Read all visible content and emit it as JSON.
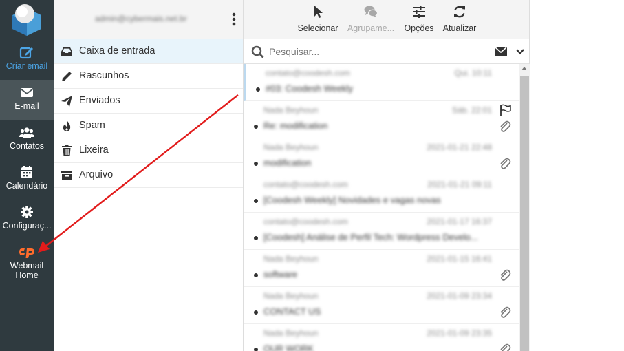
{
  "nav": {
    "items": [
      {
        "label": "Criar email",
        "icon": "compose-icon"
      },
      {
        "label": "E-mail",
        "icon": "envelope-icon"
      },
      {
        "label": "Contatos",
        "icon": "contacts-icon"
      },
      {
        "label": "Calendário",
        "icon": "calendar-icon"
      },
      {
        "label": "Configuraç...",
        "icon": "gear-icon"
      },
      {
        "label": "Webmail Home",
        "icon": "cpanel-icon"
      }
    ],
    "colors": {
      "bg": "#2f3a3f",
      "active": "#4a5559",
      "create": "#4ca5e6",
      "cpanel": "#ff6c2c"
    }
  },
  "account": {
    "email": "admin@cybermais.net.br"
  },
  "folders": [
    {
      "label": "Caixa de entrada",
      "icon": "inbox-icon"
    },
    {
      "label": "Rascunhos",
      "icon": "pencil-icon"
    },
    {
      "label": "Enviados",
      "icon": "paper-plane-icon"
    },
    {
      "label": "Spam",
      "icon": "fire-icon"
    },
    {
      "label": "Lixeira",
      "icon": "trash-icon"
    },
    {
      "label": "Arquivo",
      "icon": "archive-icon"
    }
  ],
  "toolbar": {
    "select": "Selecionar",
    "group": "Agrupame...",
    "options": "Opções",
    "refresh": "Atualizar"
  },
  "search": {
    "placeholder": "Pesquisar..."
  },
  "messages": [
    {
      "from": "contato@coodesh.com",
      "date": "Qui. 10:11",
      "subject": "#03: Coodesh Weekly"
    },
    {
      "from": "Nada Beyhoun",
      "date": "Sáb. 22:01",
      "subject": "Re: modification",
      "attachment": true,
      "flag": true
    },
    {
      "from": "Nada Beyhoun",
      "date": "2021-01-21 22:48",
      "subject": "modification",
      "attachment": true
    },
    {
      "from": "contato@coodesh.com",
      "date": "2021-01-21 09:11",
      "subject": "[Coodesh Weekly] Novidades e vagas novas"
    },
    {
      "from": "contato@coodesh.com",
      "date": "2021-01-17 16:37",
      "subject": "[Coodesh] Análise de Perfil Tech: Wordpress Develo..."
    },
    {
      "from": "Nada Beyhoun",
      "date": "2021-01-15 16:41",
      "subject": "software",
      "attachment": true
    },
    {
      "from": "Nada Beyhoun",
      "date": "2021-01-09 23:34",
      "subject": "CONTACT US",
      "attachment": true
    },
    {
      "from": "Nada Beyhoun",
      "date": "2021-01-09 23:35",
      "subject": "OUR WORK",
      "attachment": true
    }
  ],
  "annotation": {
    "color": "#e21b1b"
  }
}
